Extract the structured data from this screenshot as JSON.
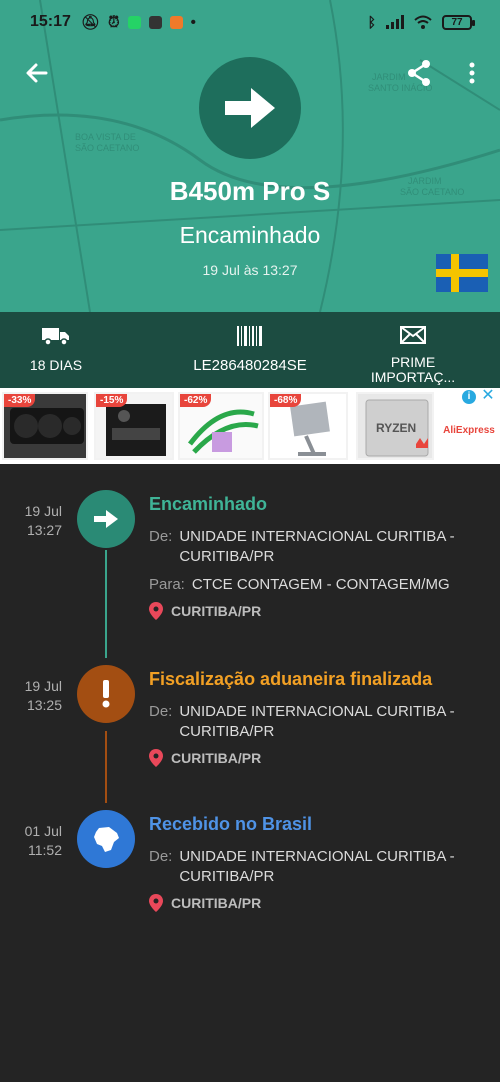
{
  "statusbar": {
    "time": "15:17",
    "battery": "77"
  },
  "header": {
    "title": "B450m Pro S",
    "status": "Encaminhado",
    "date": "19 Jul às 13:27"
  },
  "map": {
    "labels": [
      "BOA VISTA DE",
      "SÃO CAETANO",
      "JARDIM",
      "SANTO INÁCIO",
      "JARDIM",
      "SÃO CAETANO"
    ]
  },
  "info": {
    "days": "18 DIAS",
    "code": "LE286480284SE",
    "prime_line1": "PRIME",
    "prime_line2": "IMPORTAÇ..."
  },
  "ads": {
    "tiles": [
      {
        "discount": "-33%"
      },
      {
        "discount": "-15%"
      },
      {
        "discount": "-62%"
      },
      {
        "discount": "-68%"
      },
      {
        "brand": "RYZEN"
      }
    ],
    "store": "AliExpress"
  },
  "events": [
    {
      "date": "19 Jul",
      "time": "13:27",
      "title": "Encaminhado",
      "color": "#3aa58c",
      "icon": "arrow-icon",
      "from_key": "De:",
      "from_value_1": "UNIDADE INTERNACIONAL CURITIBA -",
      "from_value_2": "CURITIBA/PR",
      "to_key": "Para:",
      "to_value": "CTCE CONTAGEM - CONTAGEM/MG",
      "location": "CURITIBA/PR"
    },
    {
      "date": "19 Jul",
      "time": "13:25",
      "title": "Fiscalização aduaneira finalizada",
      "color": "#f2a024",
      "circle_color": "#a34e12",
      "icon": "exclamation-icon",
      "from_key": "De:",
      "from_value_1": "UNIDADE INTERNACIONAL CURITIBA -",
      "from_value_2": "CURITIBA/PR",
      "location": "CURITIBA/PR"
    },
    {
      "date": "01 Jul",
      "time": "11:52",
      "title": "Recebido no Brasil",
      "color": "#4f93e6",
      "circle_color": "#2f78d6",
      "icon": "brazil-map-icon",
      "from_key": "De:",
      "from_value_1": "UNIDADE INTERNACIONAL CURITIBA -",
      "from_value_2": "CURITIBA/PR",
      "location": "CURITIBA/PR"
    }
  ]
}
